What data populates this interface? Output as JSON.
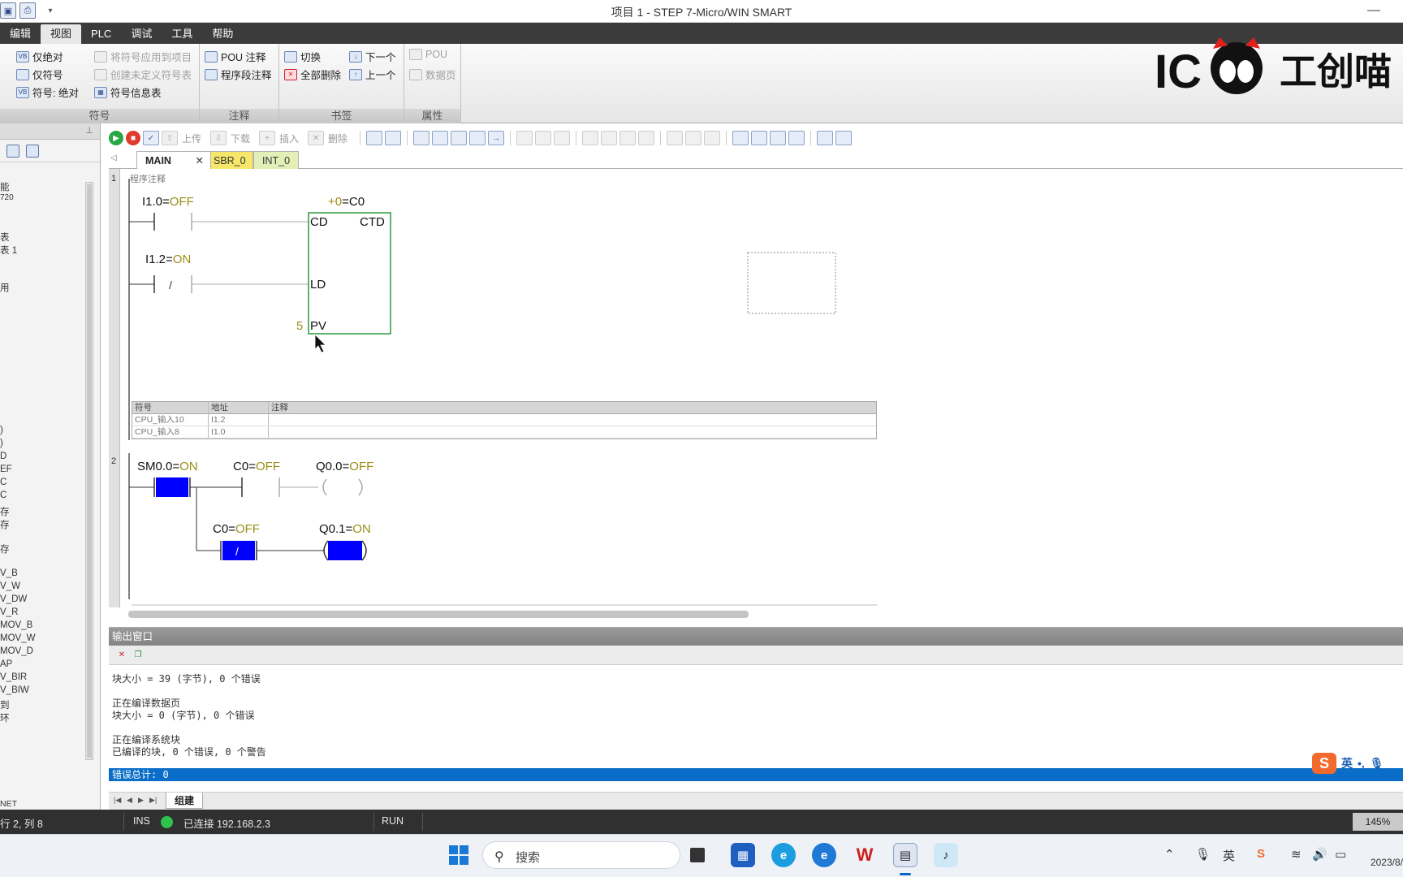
{
  "window": {
    "title": "项目 1 - STEP 7-Micro/WIN SMART",
    "minimize_glyph": "—"
  },
  "quick_access": [
    "save-icon",
    "print-icon"
  ],
  "menu": [
    "编辑",
    "视图",
    "PLC",
    "调试",
    "工具",
    "帮助"
  ],
  "ribbon": {
    "symbol_group": {
      "label": "符号",
      "items": [
        "仅绝对",
        "仅符号",
        "符号: 绝对",
        "将符号应用到项目",
        "创建未定义符号表",
        "符号信息表"
      ]
    },
    "comment_group": {
      "label": "注释",
      "items": [
        "POU 注释",
        "程序段注释"
      ]
    },
    "bookmark_group": {
      "label": "书签",
      "items": [
        "切换",
        "全部删除",
        "下一个",
        "上一个"
      ]
    },
    "property_group": {
      "label": "属性",
      "items": [
        "POU",
        "数据页"
      ]
    }
  },
  "brand": {
    "text_latin": "IC",
    "text_cn": "工创喵"
  },
  "left_pane": {
    "texts": [
      "能",
      "720",
      "表",
      "表 1",
      "用",
      ")",
      ")",
      "D",
      "EF",
      "C",
      "C",
      "存",
      "存",
      "存",
      "V_B",
      "V_W",
      "V_DW",
      "V_R",
      "MOV_B",
      "MOV_W",
      "MOV_D",
      "AP",
      "V_BIR",
      "V_BIW",
      "到",
      "环",
      "NET"
    ]
  },
  "editor_toolbar": {
    "upload": "上传",
    "download": "下载",
    "insert": "插入",
    "delete": "删除"
  },
  "tabs": [
    "MAIN",
    "SBR_0",
    "INT_0"
  ],
  "program_comment": "程序注释",
  "network1": {
    "number": "1",
    "contact1": {
      "addr": "I1.0",
      "state": "OFF"
    },
    "contact2": {
      "addr": "I1.2",
      "state": "ON",
      "symbol": "/"
    },
    "counter": {
      "preset_prefix": "+0",
      "addr": "C0",
      "type": "CTD",
      "pins": [
        "CD",
        "LD",
        "PV"
      ],
      "pv_value": "5"
    },
    "symbol_table": {
      "headers": [
        "符号",
        "地址",
        "注释"
      ],
      "rows": [
        [
          "CPU_输入10",
          "I1.2",
          ""
        ],
        [
          "CPU_输入8",
          "I1.0",
          ""
        ]
      ]
    }
  },
  "network2": {
    "number": "2",
    "sm": {
      "addr": "SM0.0",
      "state": "ON"
    },
    "c0_no": {
      "addr": "C0",
      "state": "OFF"
    },
    "q00": {
      "addr": "Q0.0",
      "state": "OFF"
    },
    "c0_nc": {
      "addr": "C0",
      "state": "OFF",
      "symbol": "/"
    },
    "q01": {
      "addr": "Q0.1",
      "state": "ON"
    }
  },
  "colors": {
    "state": "#9a8d17",
    "active": "#0000ff",
    "accent": "#0a6ec9"
  },
  "output": {
    "title": "输出窗口",
    "lines": [
      "块大小 = 39 (字节), 0 个错误",
      "",
      "正在编译数据页",
      "块大小 = 0 (字节), 0 个错误",
      "",
      "正在编译系统块",
      "已编译的块, 0 个错误, 0 个警告"
    ],
    "error_total": "错误总计: 0",
    "nav_tab": "组建"
  },
  "ime": {
    "logo": "S",
    "mode": "英",
    "punct": "•,",
    "mic": "mic-icon"
  },
  "status": {
    "position": "行 2, 列 8",
    "mode": "INS",
    "connection": "已连接 192.168.2.3",
    "plc_state": "RUN",
    "zoom": "145%"
  },
  "taskbar": {
    "search": "搜索",
    "tray_lang": "英",
    "date": "2023/8/"
  }
}
